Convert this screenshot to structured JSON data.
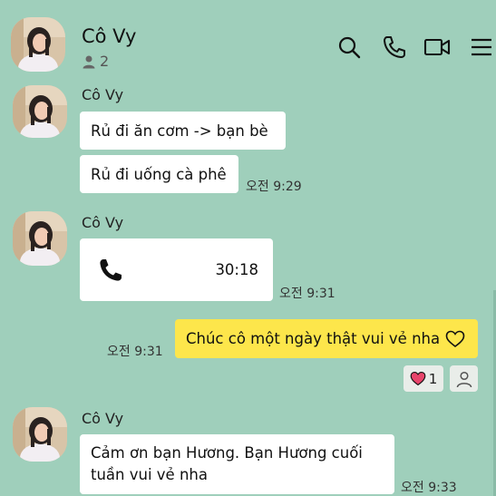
{
  "header": {
    "contact_name": "Cô Vy",
    "member_count": "2",
    "icons": [
      "search-icon",
      "phone-icon",
      "video-icon",
      "menu-icon"
    ]
  },
  "messages": {
    "group1": {
      "sender": "Cô Vy",
      "bubble1": "Rủ đi ăn cơm -> bạn bè",
      "bubble2": "Rủ đi uống cà phê",
      "time": "오전 9:29"
    },
    "group2": {
      "sender": "Cô Vy",
      "call_duration": "30:18",
      "time": "오전 9:31"
    },
    "outgoing": {
      "text": "Chúc cô một ngày thật vui vẻ nha",
      "time": "오전 9:31",
      "reaction_count": "1"
    },
    "group3": {
      "sender": "Cô Vy",
      "text_line1": "Cảm ơn bạn Hương. Bạn Hương cuối",
      "text_line2": "tuần vui vẻ nha",
      "time": "오전 9:33"
    }
  },
  "colors": {
    "background": "#9fcfbb",
    "outgoing_bubble": "#fde64b",
    "incoming_bubble": "#ffffff",
    "heart": "#e8456b"
  }
}
